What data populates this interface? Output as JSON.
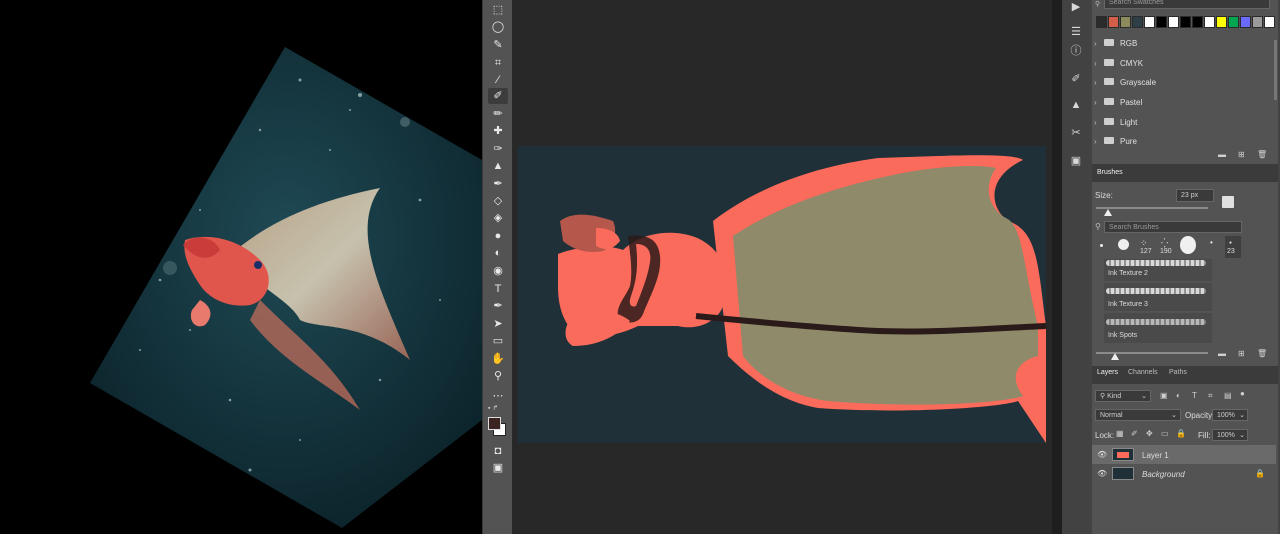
{
  "swatches_panel": {
    "search_placeholder": "Search Swatches",
    "swatch_colors": [
      "#2b2b2b",
      "#d35f4a",
      "#8d8a5c",
      "#2d3f45",
      "#ffffff",
      "#000000",
      "#ffffff",
      "#000000",
      "#000000",
      "#ffffff",
      "#ffff00",
      "#00a651",
      "#6a6aff",
      "#9a9a9a",
      "#ffffff"
    ],
    "groups": [
      {
        "label": "RGB"
      },
      {
        "label": "CMYK"
      },
      {
        "label": "Grayscale"
      },
      {
        "label": "Pastel"
      },
      {
        "label": "Light"
      },
      {
        "label": "Pure"
      }
    ]
  },
  "brushes_panel": {
    "tab_label": "Brushes",
    "size_label": "Size:",
    "size_value": "23 px",
    "search_placeholder": "Search Brushes",
    "preset_sizes": [
      "127",
      "190",
      "23"
    ],
    "brush_names": [
      "Ink Texture 2",
      "Ink Texture 3",
      "Ink Spots"
    ]
  },
  "layers_panel": {
    "tabs": [
      "Layers",
      "Channels",
      "Paths"
    ],
    "filter_kind": "Kind",
    "blend_mode": "Normal",
    "opacity_label": "Opacity:",
    "opacity_value": "100%",
    "lock_label": "Lock:",
    "fill_label": "Fill:",
    "fill_value": "100%",
    "layers": [
      {
        "name": "Layer 1",
        "selected": true
      },
      {
        "name": "Background",
        "selected": false,
        "locked": true
      }
    ]
  },
  "toolbar": {
    "tools": [
      "marquee-icon",
      "lasso-icon",
      "quick-select-icon",
      "crop-icon",
      "eyedropper-icon",
      "brush-icon",
      "pencil-icon",
      "healing-icon",
      "mixer-brush-icon",
      "stamp-icon",
      "history-brush-icon",
      "eraser-icon",
      "paint-bucket-icon",
      "blur-icon",
      "dodge-icon",
      "sponge-icon",
      "type-icon",
      "pen-icon",
      "path-select-icon",
      "rectangle-icon",
      "hand-icon",
      "zoom-icon",
      "more-icon"
    ],
    "foreground_color": "#3a2320",
    "background_color": "#ffffff"
  },
  "colors": {
    "canvas_bg": "#1f3038",
    "fill_body": "#fa6b5b",
    "fill_wing": "#8f8a6a",
    "fill_dark": "#2b1a1a",
    "fill_brown": "#b5574a"
  }
}
